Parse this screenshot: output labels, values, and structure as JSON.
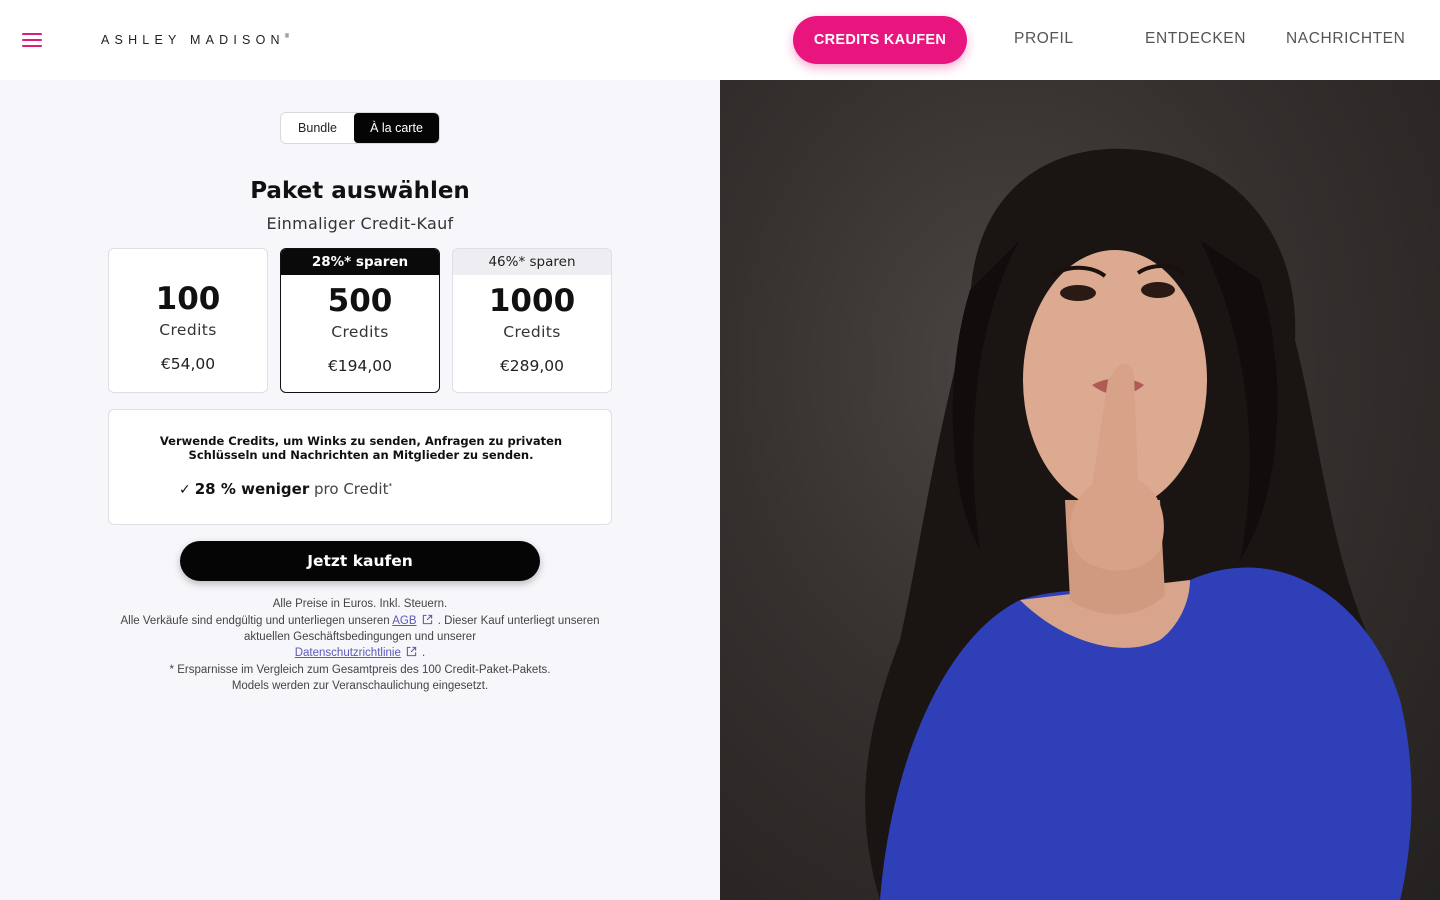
{
  "header": {
    "logo": "ASHLEY MADISON",
    "logo_mark": "®",
    "cta": "CREDITS KAUFEN",
    "nav": [
      "PROFIL",
      "ENTDECKEN",
      "NACHRICHTEN"
    ]
  },
  "toggle": {
    "bundle": "Bundle",
    "alacarte": "À la carte",
    "selected": "À la carte"
  },
  "heading": {
    "title": "Paket auswählen",
    "subtitle": "Einmaliger Credit-Kauf"
  },
  "packages": [
    {
      "amount": "100",
      "unit": "Credits",
      "price": "€54,00",
      "badge": ""
    },
    {
      "amount": "500",
      "unit": "Credits",
      "price": "€194,00",
      "badge": "28%* sparen",
      "selected": true
    },
    {
      "amount": "1000",
      "unit": "Credits",
      "price": "€289,00",
      "badge": "46%* sparen"
    }
  ],
  "info": {
    "text": "Verwende Credits, um Winks zu senden, Anfragen zu privaten Schlüsseln und Nachrichten an Mitglieder zu senden.",
    "check_icon": "checkmark-icon",
    "saving_bold": "28 % weniger",
    "saving_rest": "pro Credit",
    "saving_mark": "*"
  },
  "buy_button": "Jetzt kaufen",
  "fine_print": {
    "line1": "Alle Preise in Euros. Inkl. Steuern.",
    "line2_before": "Alle Verkäufe sind endgültig und unterliegen unseren",
    "agb": "AGB",
    "line2_after": ". Dieser Kauf unterliegt unseren aktuellen Geschäftsbedingungen und unserer",
    "privacy": "Datenschutzrichtlinie",
    "line2_end": ".",
    "line3": "* Ersparnisse im Vergleich zum Gesamtpreis des 100 Credit-Paket-Pakets.",
    "line4": "Models werden zur Veranschaulichung eingesetzt."
  },
  "colors": {
    "accent": "#e8157f",
    "dark": "#050505",
    "panel_bg": "#f7f7fb",
    "link": "#5a5ab8"
  }
}
